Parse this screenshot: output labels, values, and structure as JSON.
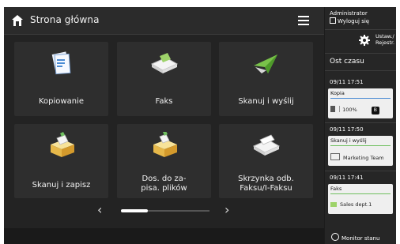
{
  "header": {
    "title": "Strona główna"
  },
  "tiles": [
    {
      "label": "Kopiowanie",
      "icon": "copy-icon"
    },
    {
      "label": "Faks",
      "icon": "fax-icon"
    },
    {
      "label": "Skanuj i wyślij",
      "icon": "scan-send-icon"
    },
    {
      "label": "Skanuj i zapisz",
      "icon": "scan-save-icon"
    },
    {
      "label": "Dos. do za-\npisa. plików",
      "icon": "access-files-icon"
    },
    {
      "label": "Skrzynka odb.\nFaksu/I-Faksu",
      "icon": "fax-inbox-icon"
    }
  ],
  "pager": {
    "prev": "‹",
    "next": "›"
  },
  "side": {
    "user": "Administrator",
    "logout": "Wyloguj się",
    "settings_line1": "Ustaw./",
    "settings_line2": "Rejestr.",
    "history_title": "Ost czasu",
    "jobs": [
      {
        "time": "09/11 17:51",
        "name": "Kopia",
        "detail": "100%",
        "badge": "B",
        "accent": "#4a8bd4"
      },
      {
        "time": "09/11 17:50",
        "name": "Skanuj i wyślij",
        "detail": "Marketing Team",
        "accent": "#6fbf5f"
      },
      {
        "time": "09/11 17:41",
        "name": "Faks",
        "detail": "Sales dept.1",
        "accent": "#6fbf5f"
      }
    ],
    "monitor": "Monitor stanu"
  }
}
